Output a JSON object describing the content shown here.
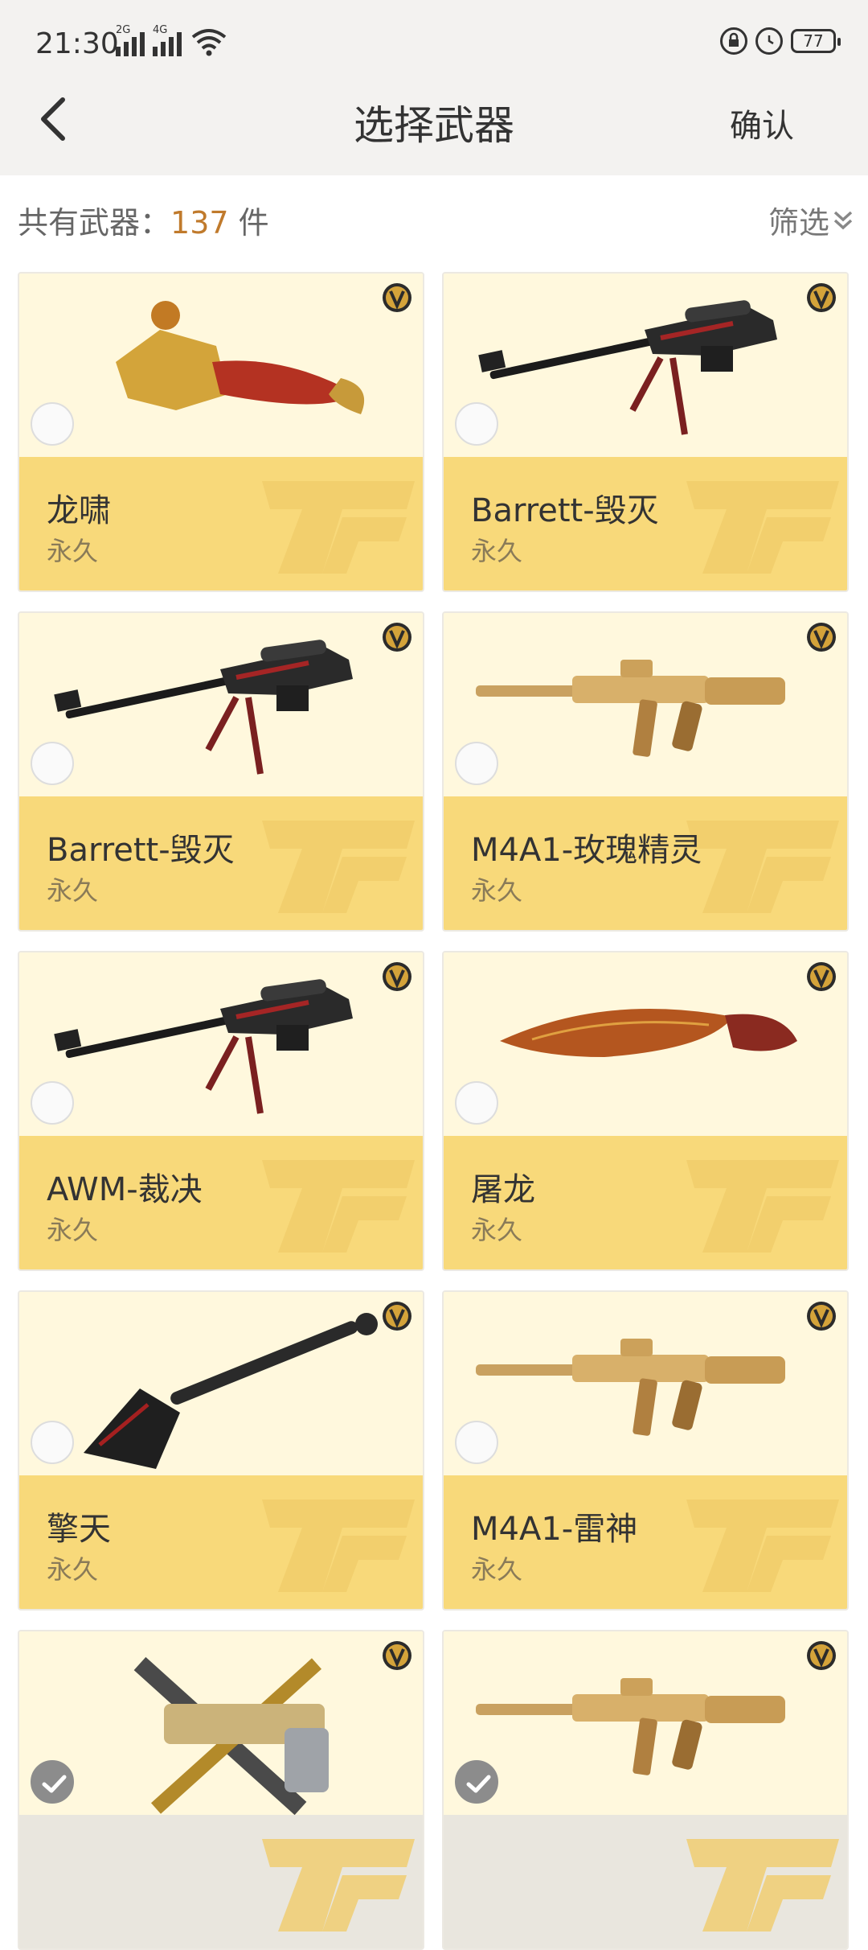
{
  "status": {
    "time": "21:30",
    "sim1": "2G",
    "sim2": "4G",
    "battery": "77"
  },
  "header": {
    "title": "选择武器",
    "confirm": "确认"
  },
  "summary": {
    "prefix": "共有武器：",
    "count": "137",
    "suffix": "件"
  },
  "filter": {
    "label": "筛选"
  },
  "weapons": [
    {
      "name": "龙啸",
      "duration": "永久",
      "icon": "axe",
      "selected": false
    },
    {
      "name": "Barrett-毁灭",
      "duration": "永久",
      "icon": "sniper-rifle",
      "selected": false
    },
    {
      "name": "Barrett-毁灭",
      "duration": "永久",
      "icon": "sniper-rifle",
      "selected": false
    },
    {
      "name": "M4A1-玫瑰精灵",
      "duration": "永久",
      "icon": "assault-rifle",
      "selected": false
    },
    {
      "name": "AWM-裁决",
      "duration": "永久",
      "icon": "sniper-rifle",
      "selected": false
    },
    {
      "name": "屠龙",
      "duration": "永久",
      "icon": "knife",
      "selected": false
    },
    {
      "name": "擎天",
      "duration": "永久",
      "icon": "shovel",
      "selected": false
    },
    {
      "name": "M4A1-雷神",
      "duration": "永久",
      "icon": "assault-rifle",
      "selected": false
    },
    {
      "name": "",
      "duration": "",
      "icon": "pistol",
      "selected": true
    },
    {
      "name": "",
      "duration": "",
      "icon": "assault-rifle",
      "selected": true
    }
  ],
  "colors": {
    "accent_count": "#c07a2c",
    "card_band": "#f8d97a",
    "card_image_bg": "#fff8dd",
    "header_bg": "#f3f2f0"
  }
}
